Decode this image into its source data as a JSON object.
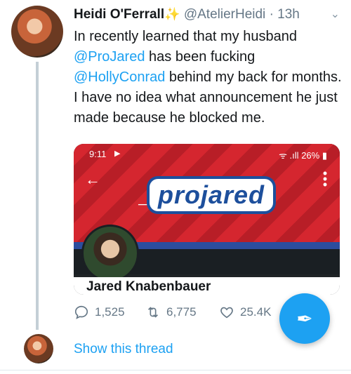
{
  "tweet": {
    "author_name": "Heidi O'Ferrall",
    "author_badge": "✨",
    "author_handle": "@AtelierHeidi",
    "separator": "·",
    "age": "13h",
    "text_parts": {
      "p1": "In recently learned that my husband ",
      "m1": "@ProJared",
      "p2": " has been fucking ",
      "m2": "@HollyConrad",
      "p3": " behind my back for months. I have no idea what announcement he just made because he blocked me."
    }
  },
  "embed": {
    "status_time": "9:11",
    "status_signal": "ᯤ .ıll",
    "status_battery": "26%",
    "logo_text": "projared",
    "profile_display_name": "Jared Knabenbauer"
  },
  "actions": {
    "replies": "1,525",
    "retweets": "6,775",
    "likes": "25.4K"
  },
  "footer": {
    "show_thread_label": "Show this thread"
  },
  "colors": {
    "accent": "#1da1f2",
    "banner_red": "#d5262f",
    "logo_blue": "#1d4f9c"
  },
  "icons": {
    "reply": "reply-icon",
    "retweet": "retweet-icon",
    "like": "heart-icon",
    "compose": "compose-feather-icon",
    "caret": "chevron-down-icon"
  }
}
